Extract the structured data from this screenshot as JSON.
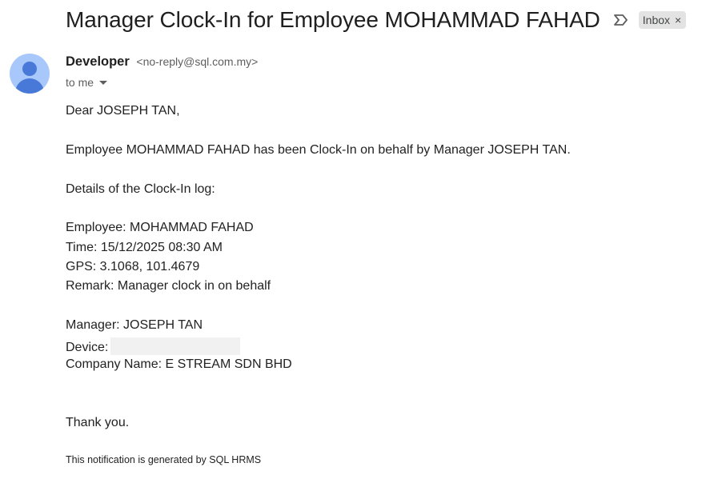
{
  "email": {
    "subject": "Manager Clock-In for Employee MOHAMMAD FAHAD",
    "label_chip": "Inbox",
    "label_chip_close": "×",
    "sender_name": "Developer",
    "sender_email": "<no-reply@sql.com.my>",
    "to_text": "to me",
    "avatar_color": "#a8c7fa",
    "avatar_figure_color": "#4979d8"
  },
  "body": {
    "greeting": "Dear JOSEPH TAN,",
    "intro": "Employee MOHAMMAD FAHAD has been Clock-In on behalf by Manager JOSEPH TAN.",
    "details_heading": "Details of the Clock-In log:",
    "employee": "Employee: MOHAMMAD FAHAD",
    "time": "Time: 15/12/2025 08:30 AM",
    "gps": "GPS: 3.1068, 101.4679",
    "remark": "Remark: Manager clock in on behalf",
    "manager": "Manager: JOSEPH TAN",
    "device_label": "Device:",
    "company": "Company Name: E STREAM SDN BHD",
    "closing": "Thank you.",
    "footer": "This notification is generated by SQL HRMS"
  }
}
